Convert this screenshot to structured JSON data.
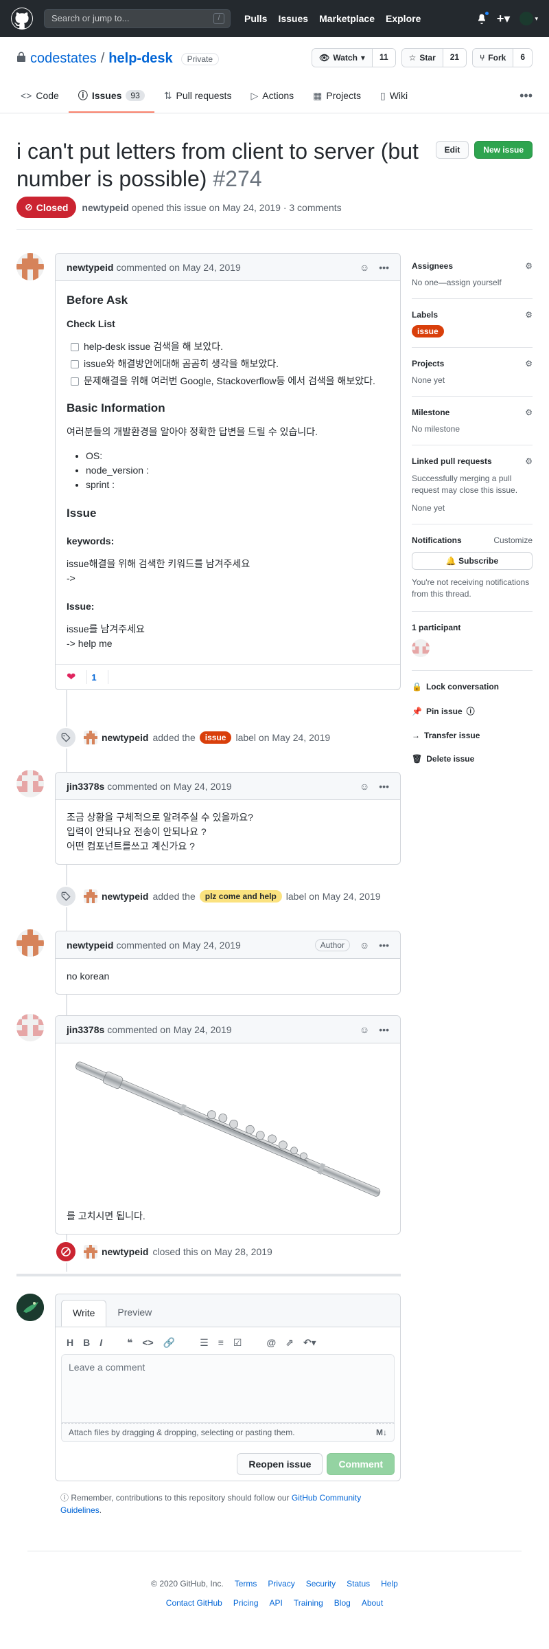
{
  "header": {
    "search_placeholder": "Search or jump to...",
    "search_key": "/",
    "nav": [
      "Pulls",
      "Issues",
      "Marketplace",
      "Explore"
    ]
  },
  "repo": {
    "owner": "codestates",
    "separator": "/",
    "name": "help-desk",
    "visibility": "Private",
    "watch_label": "Watch",
    "watch_count": "11",
    "star_label": "Star",
    "star_count": "21",
    "fork_label": "Fork",
    "fork_count": "6",
    "tabs": [
      {
        "label": "Code"
      },
      {
        "label": "Issues",
        "count": "93"
      },
      {
        "label": "Pull requests"
      },
      {
        "label": "Actions"
      },
      {
        "label": "Projects"
      },
      {
        "label": "Wiki"
      }
    ]
  },
  "issue": {
    "title": "i can't put letters from client to server (but number is possible)",
    "number": "#274",
    "edit_label": "Edit",
    "new_issue_label": "New issue",
    "state": "Closed",
    "author": "newtypeid",
    "meta_text": "opened this issue on May 24, 2019 · 3 comments"
  },
  "comments": {
    "c1": {
      "author": "newtypeid",
      "action": "commented on May 24, 2019",
      "h_before": "Before Ask",
      "h_checklist": "Check List",
      "checks": [
        "help-desk issue 검색을 해 보았다.",
        "issue와 해결방안에대해 곰곰히 생각을 해보았다.",
        "문제해결을 위해 여러번 Google, Stackoverflow등 에서 검색을 해보았다."
      ],
      "h_basic": "Basic Information",
      "basic_text": "여러분들의 개발환경을 알아야 정확한 답변을 드릴 수 있습니다.",
      "basic_items": [
        "OS:",
        "node_version :",
        "sprint :"
      ],
      "h_issue": "Issue",
      "h_keywords": "keywords:",
      "keywords_line1": "issue해결을 위해 검색한 키워드를 남겨주세요",
      "keywords_line2": "->",
      "h_issue2": "Issue:",
      "issue_line1": "issue를 남겨주세요",
      "issue_line2": "-> help me",
      "reaction_count": "1"
    },
    "e1": {
      "author": "newtypeid",
      "pre": "added the",
      "label": "issue",
      "post": "label on May 24, 2019"
    },
    "c2": {
      "author": "jin3378s",
      "action": "commented on May 24, 2019",
      "lines": [
        "조금 상황을 구체적으로 알려주실 수 있을까요?",
        "입력이 안되나요 전송이 안되나요 ?",
        "어떤 컴포넌트를쓰고 계신가요 ?"
      ]
    },
    "e2": {
      "author": "newtypeid",
      "pre": "added the",
      "label": "plz come and help",
      "post": "label on May 24, 2019"
    },
    "c3": {
      "author": "newtypeid",
      "action": "commented on May 24, 2019",
      "badge": "Author",
      "body": "no korean"
    },
    "c4": {
      "author": "jin3378s",
      "action": "commented on May 24, 2019",
      "body": "를 고치시면 됩니다."
    },
    "e3": {
      "author": "newtypeid",
      "text": "closed this on May 28, 2019"
    }
  },
  "sidebar": {
    "assignees_h": "Assignees",
    "assignees_v": "No one—assign yourself",
    "labels_h": "Labels",
    "labels_v": "issue",
    "projects_h": "Projects",
    "projects_v": "None yet",
    "milestone_h": "Milestone",
    "milestone_v": "No milestone",
    "linked_h": "Linked pull requests",
    "linked_desc": "Successfully merging a pull request may close this issue.",
    "linked_v": "None yet",
    "notif_h": "Notifications",
    "notif_customize": "Customize",
    "subscribe": "Subscribe",
    "notif_desc": "You're not receiving notifications from this thread.",
    "participants_h": "1 participant",
    "lock": "Lock conversation",
    "pin": "Pin issue",
    "transfer": "Transfer issue",
    "delete": "Delete issue"
  },
  "editor": {
    "write_tab": "Write",
    "preview_tab": "Preview",
    "placeholder": "Leave a comment",
    "attach": "Attach files by dragging & dropping, selecting or pasting them.",
    "reopen": "Reopen issue",
    "comment": "Comment",
    "note_pre": "Remember, contributions to this repository should follow our",
    "note_link": "GitHub Community Guidelines",
    "note_post": "."
  },
  "footer": {
    "copyright": "© 2020 GitHub, Inc.",
    "row1": [
      "Terms",
      "Privacy",
      "Security",
      "Status",
      "Help"
    ],
    "row2": [
      "Contact GitHub",
      "Pricing",
      "API",
      "Training",
      "Blog",
      "About"
    ]
  },
  "colors": {
    "closed": "#cb2431",
    "label_issue": "#d93f0b",
    "label_help": "#fbe27f",
    "primary": "#2ea44f",
    "link": "#0366d6"
  }
}
